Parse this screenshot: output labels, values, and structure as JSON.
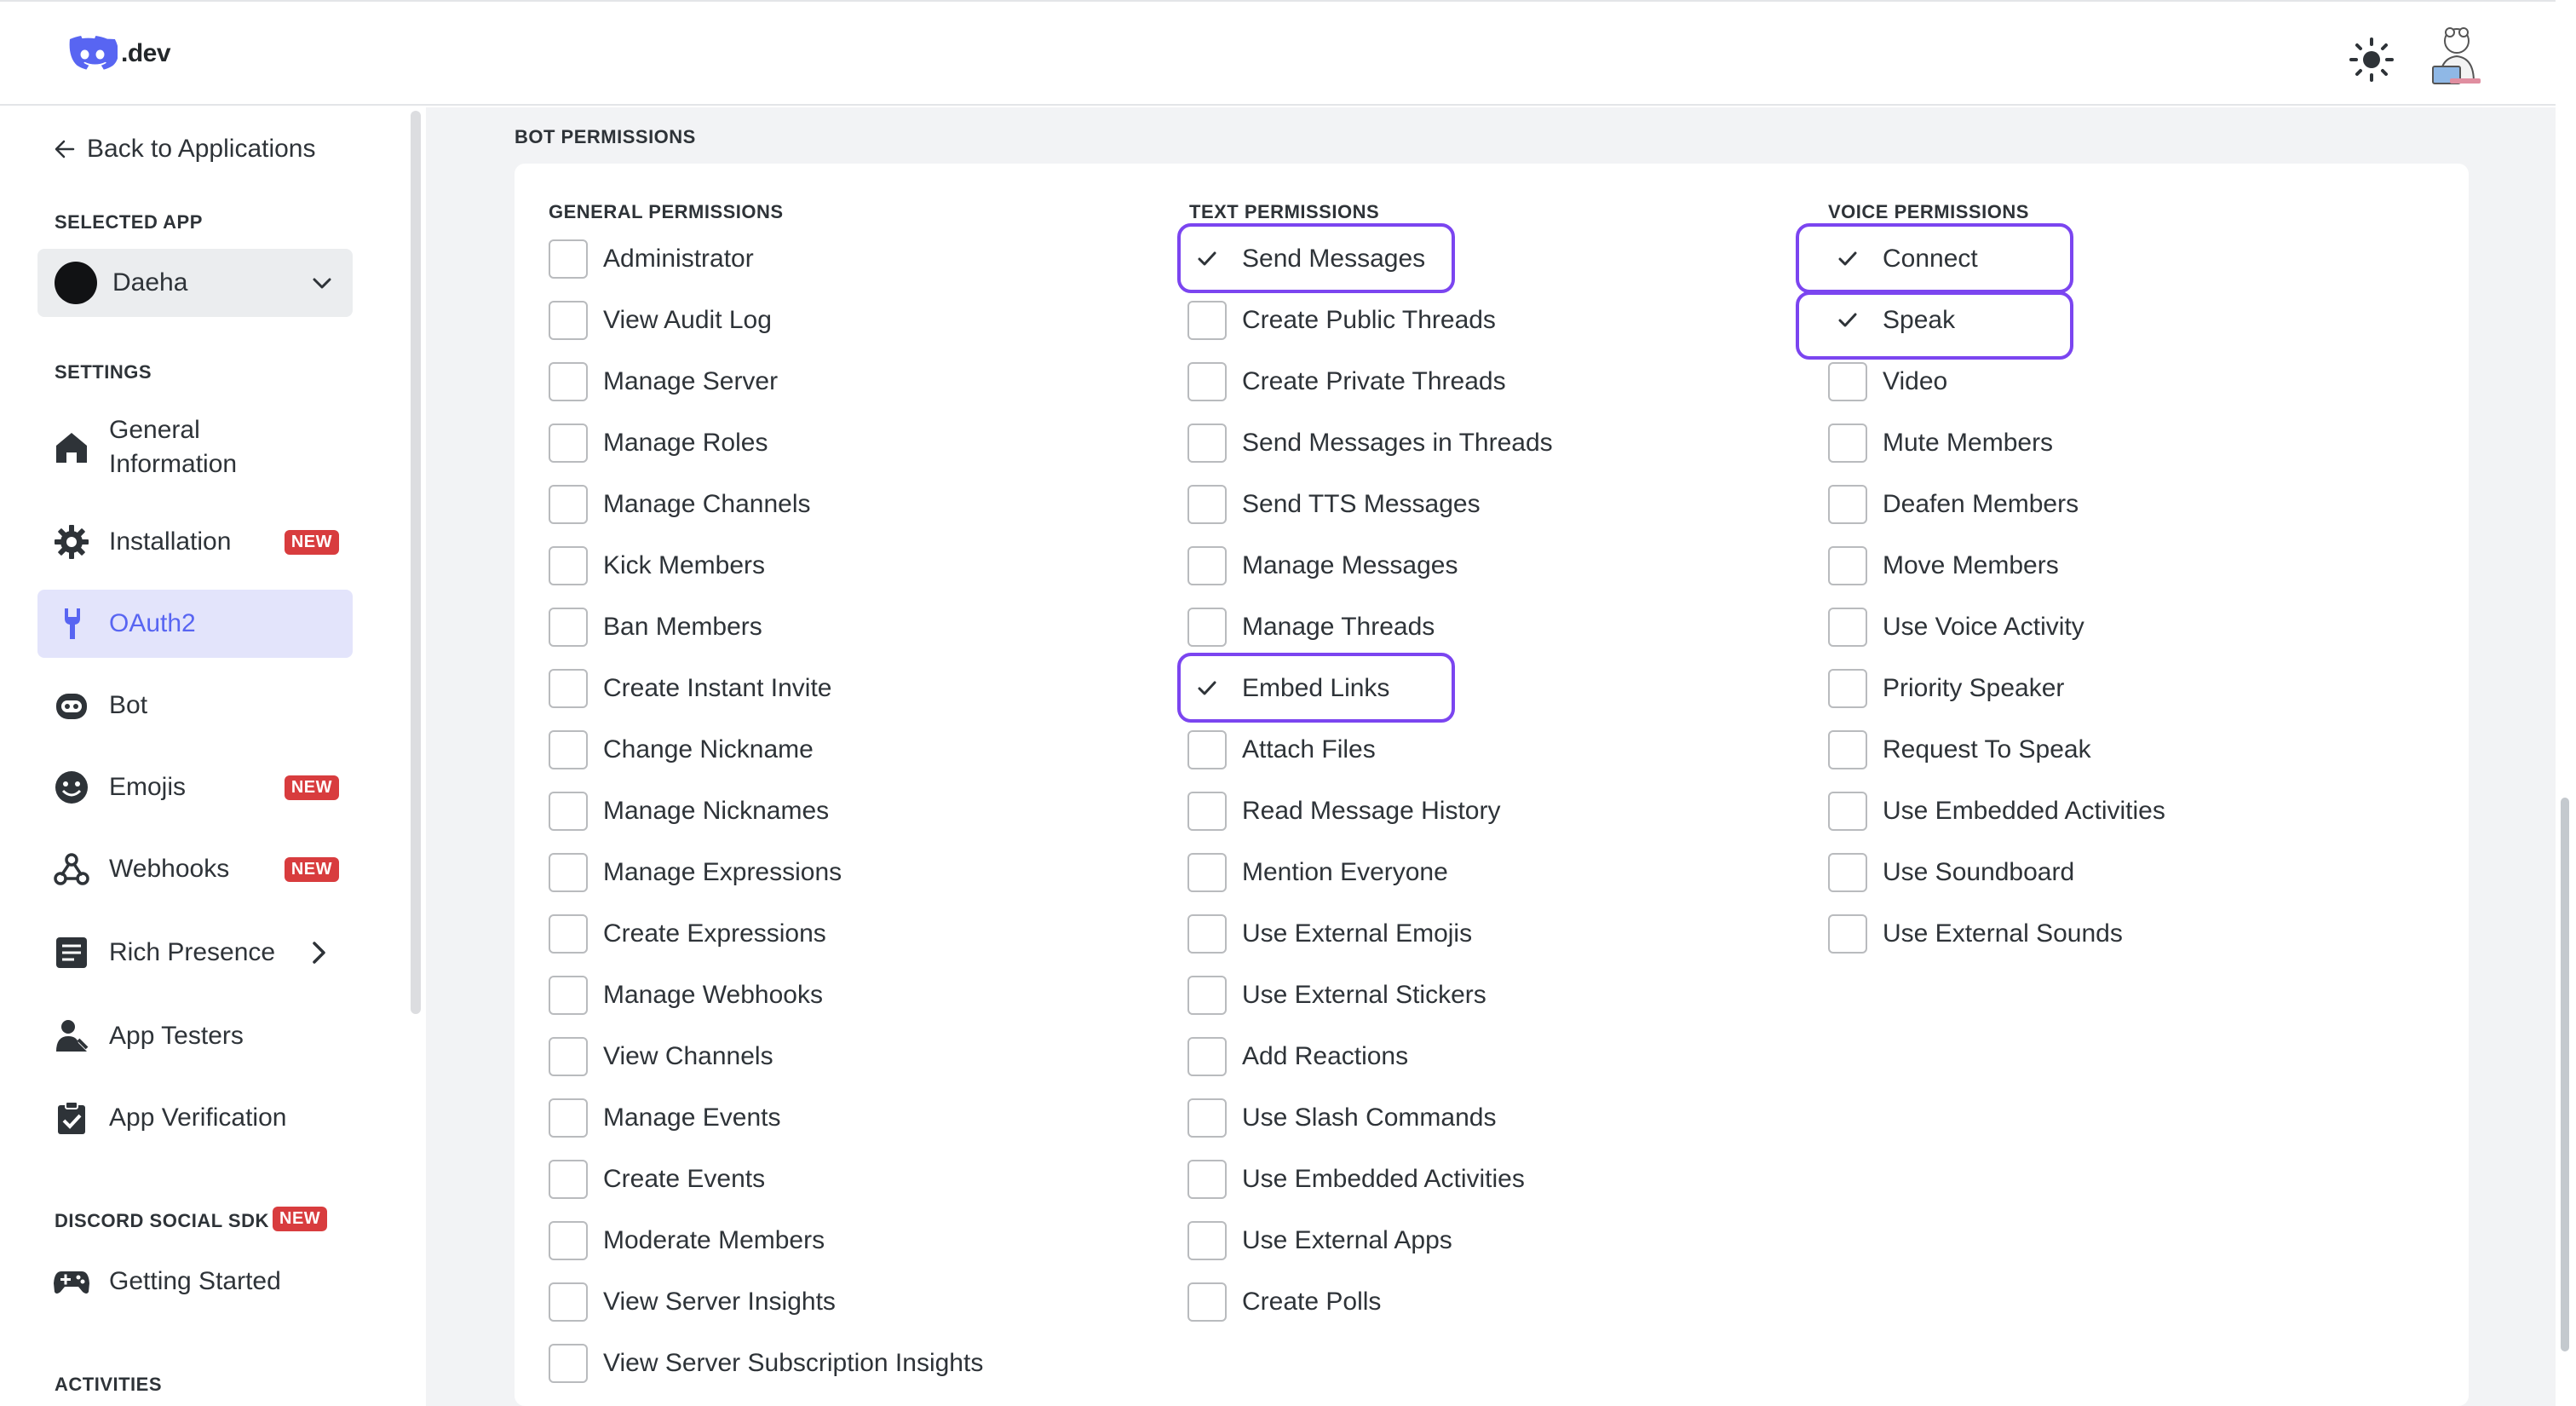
{
  "header": {
    "logo_text": ".dev",
    "logo_icon": "discord-logo-icon",
    "theme_icon": "sun-icon",
    "avatar_icon": "user-avatar"
  },
  "sidebar": {
    "back_label": "Back to Applications",
    "selected_app_heading": "SELECTED APP",
    "selected_app_name": "Daeha",
    "settings_heading": "SETTINGS",
    "items": [
      {
        "label": "General Information",
        "icon": "home-icon"
      },
      {
        "label": "Installation",
        "icon": "gear-icon",
        "badge": "NEW"
      },
      {
        "label": "OAuth2",
        "icon": "wrench-icon",
        "active": true
      },
      {
        "label": "Bot",
        "icon": "bot-icon"
      },
      {
        "label": "Emojis",
        "icon": "emoji-icon",
        "badge": "NEW"
      },
      {
        "label": "Webhooks",
        "icon": "webhook-icon",
        "badge": "NEW"
      },
      {
        "label": "Rich Presence",
        "icon": "document-icon"
      },
      {
        "label": "App Testers",
        "icon": "person-icon"
      },
      {
        "label": "App Verification",
        "icon": "clipboard-check-icon"
      }
    ],
    "social_sdk_heading": "DISCORD SOCIAL SDK",
    "social_sdk_badge": "NEW",
    "social_items": [
      {
        "label": "Getting Started",
        "icon": "gamepad-icon"
      }
    ],
    "activities_heading": "ACTIVITIES"
  },
  "main": {
    "section_title": "BOT PERMISSIONS",
    "columns": [
      {
        "heading": "GENERAL PERMISSIONS",
        "items": [
          {
            "label": "Administrator",
            "checked": false
          },
          {
            "label": "View Audit Log",
            "checked": false
          },
          {
            "label": "Manage Server",
            "checked": false
          },
          {
            "label": "Manage Roles",
            "checked": false
          },
          {
            "label": "Manage Channels",
            "checked": false
          },
          {
            "label": "Kick Members",
            "checked": false
          },
          {
            "label": "Ban Members",
            "checked": false
          },
          {
            "label": "Create Instant Invite",
            "checked": false
          },
          {
            "label": "Change Nickname",
            "checked": false
          },
          {
            "label": "Manage Nicknames",
            "checked": false
          },
          {
            "label": "Manage Expressions",
            "checked": false
          },
          {
            "label": "Create Expressions",
            "checked": false
          },
          {
            "label": "Manage Webhooks",
            "checked": false
          },
          {
            "label": "View Channels",
            "checked": false
          },
          {
            "label": "Manage Events",
            "checked": false
          },
          {
            "label": "Create Events",
            "checked": false
          },
          {
            "label": "Moderate Members",
            "checked": false
          },
          {
            "label": "View Server Insights",
            "checked": false
          },
          {
            "label": "View Server Subscription Insights",
            "checked": false
          }
        ]
      },
      {
        "heading": "TEXT PERMISSIONS",
        "items": [
          {
            "label": "Send Messages",
            "checked": true
          },
          {
            "label": "Create Public Threads",
            "checked": false
          },
          {
            "label": "Create Private Threads",
            "checked": false
          },
          {
            "label": "Send Messages in Threads",
            "checked": false
          },
          {
            "label": "Send TTS Messages",
            "checked": false
          },
          {
            "label": "Manage Messages",
            "checked": false
          },
          {
            "label": "Manage Threads",
            "checked": false
          },
          {
            "label": "Embed Links",
            "checked": true
          },
          {
            "label": "Attach Files",
            "checked": false
          },
          {
            "label": "Read Message History",
            "checked": false
          },
          {
            "label": "Mention Everyone",
            "checked": false
          },
          {
            "label": "Use External Emojis",
            "checked": false
          },
          {
            "label": "Use External Stickers",
            "checked": false
          },
          {
            "label": "Add Reactions",
            "checked": false
          },
          {
            "label": "Use Slash Commands",
            "checked": false
          },
          {
            "label": "Use Embedded Activities",
            "checked": false
          },
          {
            "label": "Use External Apps",
            "checked": false
          },
          {
            "label": "Create Polls",
            "checked": false
          }
        ]
      },
      {
        "heading": "VOICE PERMISSIONS",
        "items": [
          {
            "label": "Connect",
            "checked": true
          },
          {
            "label": "Speak",
            "checked": true
          },
          {
            "label": "Video",
            "checked": false
          },
          {
            "label": "Mute Members",
            "checked": false
          },
          {
            "label": "Deafen Members",
            "checked": false
          },
          {
            "label": "Move Members",
            "checked": false
          },
          {
            "label": "Use Voice Activity",
            "checked": false
          },
          {
            "label": "Priority Speaker",
            "checked": false
          },
          {
            "label": "Request To Speak",
            "checked": false
          },
          {
            "label": "Use Embedded Activities",
            "checked": false
          },
          {
            "label": "Use Soundboard",
            "checked": false
          },
          {
            "label": "Use External Sounds",
            "checked": false
          }
        ]
      }
    ]
  },
  "colors": {
    "accent": "#5865f2",
    "highlight": "#7b45f0",
    "badge": "#d83c3e"
  }
}
